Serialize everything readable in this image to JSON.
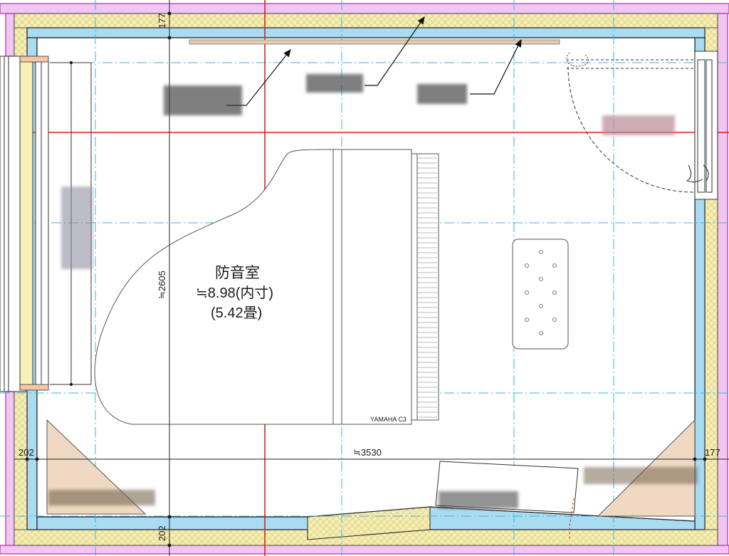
{
  "room": {
    "name": "防音室",
    "area_line": "≒8.98(内寸)",
    "tatami_line": "(5.42畳)"
  },
  "piano": {
    "model_label": "YAMAHA C3"
  },
  "dimensions": {
    "top_wall": "177",
    "right_wall": "177",
    "left_wall": "202",
    "bottom_wall": "202",
    "room_height": "≒2605",
    "room_width": "≒3530"
  },
  "colors": {
    "outer_wall": "#e79be6",
    "insulation_hatch": "#f5efb5",
    "inner_panel": "#a9dbf1",
    "corner_trap": "#efd9c3",
    "grid_red": "#e0201c",
    "grid_cyan": "#39b6e6"
  }
}
